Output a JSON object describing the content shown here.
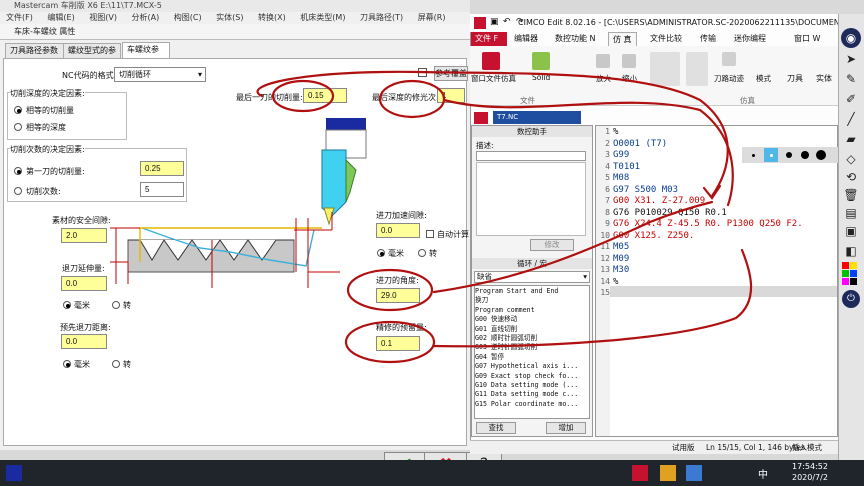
{
  "mastercam": {
    "app_title": "Mastercam 车削版 X6  E:\\11\\T7.MCX-5",
    "menu": [
      "文件(F)",
      "编辑(E)",
      "视图(V)",
      "分析(A)",
      "构图(C)",
      "实体(S)",
      "转换(X)",
      "机床类型(M)",
      "刀具路径(T)",
      "屏幕(R)"
    ],
    "dialog_title": "车床-车螺纹 属性",
    "tabs": [
      "刀具路径参数",
      "螺纹型式的参数",
      "车螺纹参数"
    ],
    "nc_format_label": "NC代码的格式:",
    "nc_format_value": "切削循环",
    "depth_group_title": "切削深度的决定因素:",
    "depth_opt1": "相等的切削量",
    "depth_opt2": "相等的深度",
    "count_group_title": "切削次数的决定因素:",
    "first_cut_label": "第一刀的切削量:",
    "first_cut_value": "0.25",
    "cut_count_label": "切削次数:",
    "cut_count_value": "5",
    "last_cut_label": "最后一刀的切削量:",
    "last_cut_value": "0.15",
    "last_depth_label": "最后深度的修光次:",
    "last_depth_value": "1",
    "override_btn": "参考覆盖",
    "stock_clear_label": "素材的安全间隙:",
    "stock_clear_value": "2.0",
    "retract_ext_label": "退刀延伸量:",
    "retract_ext_value": "0.0",
    "pre_retract_label": "预先退刀距离:",
    "pre_retract_value": "0.0",
    "accel_label": "进刀加速间隙:",
    "accel_value": "0.0",
    "auto_calc": "自动计算",
    "infeed_angle_label": "进刀的角度:",
    "infeed_angle_value": "29.0",
    "finish_allow_label": "精修的预留量:",
    "finish_allow_value": "0.1",
    "unit_mm": "毫米",
    "unit_turn": "转"
  },
  "cimco": {
    "title": "CIMCO Edit 8.02.16 - [C:\\USERS\\ADMINISTRATOR.SC-2020062211135\\DOCUMENT...",
    "ribbon_tabs": [
      "文件 F",
      "编辑器",
      "数控功能 N",
      "仿 真",
      "文件比较",
      "传输",
      "迷你编程"
    ],
    "window_menu": "窗口 W",
    "ribbon_labels": {
      "open_sim": "窗口文件仿真",
      "solid": "Solid",
      "file_group": "文件",
      "zoom_in": "放大",
      "zoom_out": "缩小",
      "toolpath": "刀路动迹",
      "mode": "模式",
      "tool": "刀具",
      "solid_cn": "实体",
      "sim_group": "仿真"
    },
    "doc_tab": "T7.NC",
    "assistant_title": "数控助手",
    "desc_label": "描述:",
    "modify_btn": "修改",
    "cycle_title": "循环 / 宏",
    "cycle_select": "缺省",
    "cycle_list": [
      "Program Start and End",
      "换刀",
      "Program comment",
      "G00 快速移动",
      "G01 直线切削",
      "G02 顺时针圆弧切削",
      "G03 逆时针圆弧切削",
      "G04 暂停",
      "G07 Hypothetical axis i...",
      "G09 Exact stop check fo...",
      "G10 Data setting mode (...",
      "G11 Data setting mode c...",
      "G15 Polar coordinate mo..."
    ],
    "find_btn": "查找",
    "add_btn": "增加",
    "code_lines": [
      {
        "n": "1",
        "t": "%"
      },
      {
        "n": "2",
        "t": "O0001 (T7)"
      },
      {
        "n": "3",
        "t": "G99"
      },
      {
        "n": "4",
        "t": "T0101"
      },
      {
        "n": "5",
        "t": "M08"
      },
      {
        "n": "6",
        "t": "G97 S500 M03"
      },
      {
        "n": "7",
        "t": "G00 X31. Z-27.009"
      },
      {
        "n": "8",
        "t": "G76 P010029 Q150 R0.1"
      },
      {
        "n": "9",
        "t": "G76 X24.4 Z-45.5 R0. P1300 Q250 F2."
      },
      {
        "n": "10",
        "t": "G00 X125. Z250."
      },
      {
        "n": "11",
        "t": "M05"
      },
      {
        "n": "12",
        "t": "M09"
      },
      {
        "n": "13",
        "t": "M30"
      },
      {
        "n": "14",
        "t": "%"
      },
      {
        "n": "15",
        "t": ""
      }
    ],
    "status_mode": "试用版",
    "status_pos": "Ln 15/15, Col 1, 146 bytes",
    "status_ins": "插入模式"
  },
  "taskbar": {
    "time": "17:54:52",
    "date": "2020/7/2",
    "ime": "中"
  },
  "colors": {
    "accent": "#c6122f",
    "field": "#ffff99",
    "annotation": "#b01010"
  }
}
